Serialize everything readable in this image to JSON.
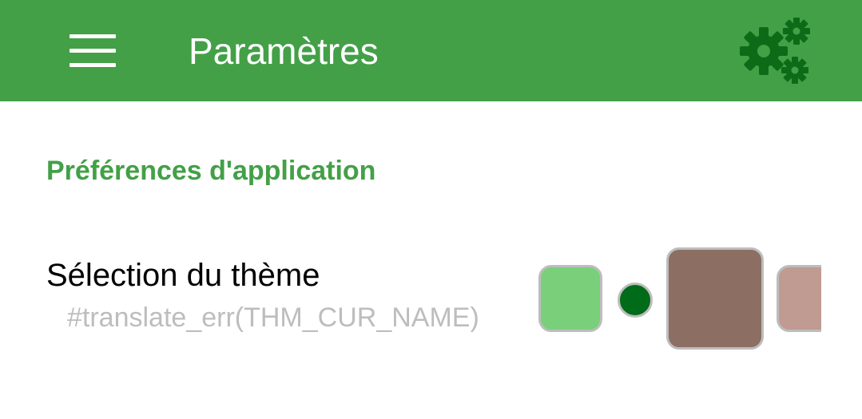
{
  "toolbar": {
    "title": "Paramètres",
    "background_color": "#43a047",
    "menu_icon": "hamburger-menu-icon",
    "settings_icon": "gears-icon",
    "settings_icon_color": "#0d6b18"
  },
  "preferences": {
    "section_title": "Préférences d'application",
    "section_color": "#43a047",
    "theme": {
      "title": "Sélection du thème",
      "summary": "#translate_err(THM_CUR_NAME)",
      "swatches": {
        "primary_light": "#7ad07a",
        "accent": "#006b18",
        "primary_dark": "#8c6e63",
        "secondary_light": "#bf9b92"
      }
    }
  }
}
